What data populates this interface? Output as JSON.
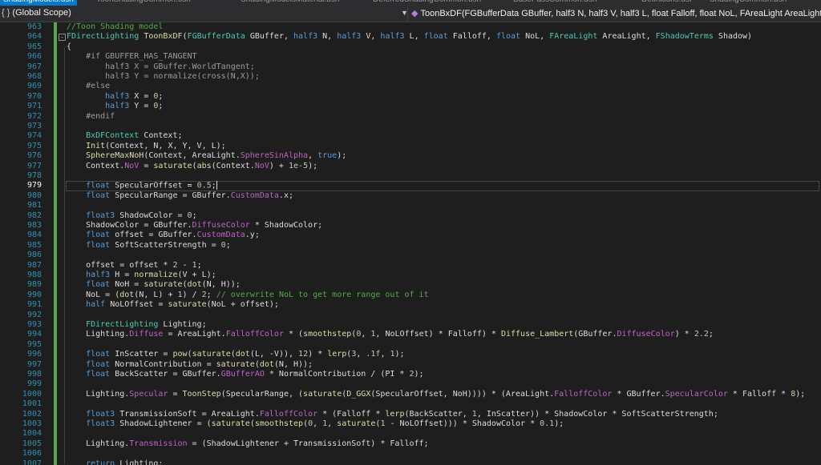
{
  "tabs": [
    {
      "label": "ShadingModels.ush",
      "active": true
    },
    {
      "label": "ToonShadingCommon.ush",
      "active": false
    },
    {
      "label": "ShadingModelsMaterial.ush",
      "active": false
    },
    {
      "label": "DeferredShadingCommon.ush",
      "active": false
    },
    {
      "label": "BasePassCommon.ush",
      "active": false
    },
    {
      "label": "Definitions.usf",
      "active": false
    },
    {
      "label": "ShadingCommon.ush",
      "active": false
    }
  ],
  "navbar": {
    "scope_icon": "{ }",
    "scope_label": "(Global Scope)",
    "function_label": "ToonBxDF(FGBufferData GBuffer, half3 N, half3 V, half3 L, float Falloff, float NoL, FAreaLight AreaLight, FShadowTerms Shadow)",
    "function_icon": "cube-icon"
  },
  "editor": {
    "current_line": 979,
    "lines": [
      {
        "n": "963",
        "tokens": [
          {
            "c": "c",
            "t": "//Toon Shading model"
          }
        ]
      },
      {
        "n": "964",
        "fold": "-",
        "tokens": [
          {
            "c": "t",
            "t": "FDirectLighting"
          },
          {
            "c": "v",
            "t": " "
          },
          {
            "c": "f",
            "t": "ToonBxDF"
          },
          {
            "c": "v",
            "t": "("
          },
          {
            "c": "t",
            "t": "FGBufferData"
          },
          {
            "c": "v",
            "t": " GBuffer, "
          },
          {
            "c": "k",
            "t": "half3"
          },
          {
            "c": "v",
            "t": " N, "
          },
          {
            "c": "k",
            "t": "half3"
          },
          {
            "c": "v",
            "t": " V, "
          },
          {
            "c": "k",
            "t": "half3"
          },
          {
            "c": "v",
            "t": " L, "
          },
          {
            "c": "k",
            "t": "float"
          },
          {
            "c": "v",
            "t": " Falloff, "
          },
          {
            "c": "k",
            "t": "float"
          },
          {
            "c": "v",
            "t": " NoL, "
          },
          {
            "c": "t",
            "t": "FAreaLight"
          },
          {
            "c": "v",
            "t": " AreaLight, "
          },
          {
            "c": "t",
            "t": "FShadowTerms"
          },
          {
            "c": "v",
            "t": " Shadow)"
          }
        ]
      },
      {
        "n": "965",
        "tokens": [
          {
            "c": "v",
            "t": "{"
          }
        ]
      },
      {
        "n": "966",
        "tokens": [
          {
            "c": "p",
            "t": "    #if GBUFFER_HAS_TANGENT"
          }
        ]
      },
      {
        "n": "967",
        "tokens": [
          {
            "c": "p",
            "t": "        half3 X = GBuffer.WorldTangent;"
          }
        ]
      },
      {
        "n": "968",
        "tokens": [
          {
            "c": "p",
            "t": "        half3 Y = normalize(cross(N,X));"
          }
        ]
      },
      {
        "n": "969",
        "tokens": [
          {
            "c": "p",
            "t": "    #else"
          }
        ]
      },
      {
        "n": "970",
        "tokens": [
          {
            "c": "k",
            "t": "        half3"
          },
          {
            "c": "v",
            "t": " X = "
          },
          {
            "c": "n",
            "t": "0"
          },
          {
            "c": "v",
            "t": ";"
          }
        ]
      },
      {
        "n": "971",
        "tokens": [
          {
            "c": "k",
            "t": "        half3"
          },
          {
            "c": "v",
            "t": " Y = "
          },
          {
            "c": "n",
            "t": "0"
          },
          {
            "c": "v",
            "t": ";"
          }
        ]
      },
      {
        "n": "972",
        "tokens": [
          {
            "c": "p",
            "t": "    #endif"
          }
        ]
      },
      {
        "n": "973",
        "tokens": []
      },
      {
        "n": "974",
        "tokens": [
          {
            "c": "t",
            "t": "    BxDFContext"
          },
          {
            "c": "v",
            "t": " Context;"
          }
        ]
      },
      {
        "n": "975",
        "tokens": [
          {
            "c": "f",
            "t": "    Init"
          },
          {
            "c": "v",
            "t": "(Context, N, X, Y, V, L);"
          }
        ]
      },
      {
        "n": "976",
        "tokens": [
          {
            "c": "f",
            "t": "    SphereMaxNoH"
          },
          {
            "c": "v",
            "t": "(Context, AreaLight."
          },
          {
            "c": "m",
            "t": "SphereSinAlpha"
          },
          {
            "c": "v",
            "t": ", "
          },
          {
            "c": "k",
            "t": "true"
          },
          {
            "c": "v",
            "t": ");"
          }
        ]
      },
      {
        "n": "977",
        "tokens": [
          {
            "c": "v",
            "t": "    Context."
          },
          {
            "c": "m",
            "t": "NoV"
          },
          {
            "c": "v",
            "t": " = "
          },
          {
            "c": "f",
            "t": "saturate"
          },
          {
            "c": "v",
            "t": "("
          },
          {
            "c": "f",
            "t": "abs"
          },
          {
            "c": "v",
            "t": "(Context."
          },
          {
            "c": "m",
            "t": "NoV"
          },
          {
            "c": "v",
            "t": ") + "
          },
          {
            "c": "n",
            "t": "1e-5"
          },
          {
            "c": "v",
            "t": ");"
          }
        ]
      },
      {
        "n": "978",
        "tokens": []
      },
      {
        "n": "979",
        "cursor": true,
        "tokens": [
          {
            "c": "k",
            "t": "    float"
          },
          {
            "c": "v",
            "t": " SpecularOffset = "
          },
          {
            "c": "n",
            "t": "0.5"
          },
          {
            "c": "v",
            "t": ";"
          }
        ]
      },
      {
        "n": "980",
        "tokens": [
          {
            "c": "k",
            "t": "    float"
          },
          {
            "c": "v",
            "t": " SpecularRange = GBuffer."
          },
          {
            "c": "m",
            "t": "CustomData"
          },
          {
            "c": "v",
            "t": ".x;"
          }
        ]
      },
      {
        "n": "981",
        "tokens": []
      },
      {
        "n": "982",
        "tokens": [
          {
            "c": "k",
            "t": "    float3"
          },
          {
            "c": "v",
            "t": " ShadowColor = "
          },
          {
            "c": "n",
            "t": "0"
          },
          {
            "c": "v",
            "t": ";"
          }
        ]
      },
      {
        "n": "983",
        "tokens": [
          {
            "c": "v",
            "t": "    ShadowColor = GBuffer."
          },
          {
            "c": "m",
            "t": "DiffuseColor"
          },
          {
            "c": "v",
            "t": " * ShadowColor;"
          }
        ]
      },
      {
        "n": "984",
        "tokens": [
          {
            "c": "k",
            "t": "    float"
          },
          {
            "c": "v",
            "t": " offset = GBuffer."
          },
          {
            "c": "m",
            "t": "CustomData"
          },
          {
            "c": "v",
            "t": ".y;"
          }
        ]
      },
      {
        "n": "985",
        "tokens": [
          {
            "c": "k",
            "t": "    float"
          },
          {
            "c": "v",
            "t": " SoftScatterStrength = "
          },
          {
            "c": "n",
            "t": "0"
          },
          {
            "c": "v",
            "t": ";"
          }
        ]
      },
      {
        "n": "986",
        "tokens": []
      },
      {
        "n": "987",
        "tokens": [
          {
            "c": "v",
            "t": "    offset = offset * "
          },
          {
            "c": "n",
            "t": "2"
          },
          {
            "c": "v",
            "t": " - "
          },
          {
            "c": "n",
            "t": "1"
          },
          {
            "c": "v",
            "t": ";"
          }
        ]
      },
      {
        "n": "988",
        "tokens": [
          {
            "c": "k",
            "t": "    half3"
          },
          {
            "c": "v",
            "t": " H = "
          },
          {
            "c": "f",
            "t": "normalize"
          },
          {
            "c": "v",
            "t": "(V + L);"
          }
        ]
      },
      {
        "n": "989",
        "tokens": [
          {
            "c": "k",
            "t": "    float"
          },
          {
            "c": "v",
            "t": " NoH = "
          },
          {
            "c": "f",
            "t": "saturate"
          },
          {
            "c": "v",
            "t": "("
          },
          {
            "c": "f",
            "t": "dot"
          },
          {
            "c": "v",
            "t": "(N, H));"
          }
        ]
      },
      {
        "n": "990",
        "tokens": [
          {
            "c": "v",
            "t": "    NoL = ("
          },
          {
            "c": "f",
            "t": "dot"
          },
          {
            "c": "v",
            "t": "(N, L) + "
          },
          {
            "c": "n",
            "t": "1"
          },
          {
            "c": "v",
            "t": ") / "
          },
          {
            "c": "n",
            "t": "2"
          },
          {
            "c": "v",
            "t": "; "
          },
          {
            "c": "c",
            "t": "// overwrite NoL to get more range out of it"
          }
        ]
      },
      {
        "n": "991",
        "tokens": [
          {
            "c": "k",
            "t": "    half"
          },
          {
            "c": "v",
            "t": " NoLOffset = "
          },
          {
            "c": "f",
            "t": "saturate"
          },
          {
            "c": "v",
            "t": "(NoL + offset);"
          }
        ]
      },
      {
        "n": "992",
        "tokens": []
      },
      {
        "n": "993",
        "tokens": [
          {
            "c": "t",
            "t": "    FDirectLighting"
          },
          {
            "c": "v",
            "t": " Lighting;"
          }
        ]
      },
      {
        "n": "994",
        "tokens": [
          {
            "c": "v",
            "t": "    Lighting."
          },
          {
            "c": "m",
            "t": "Diffuse"
          },
          {
            "c": "v",
            "t": " = AreaLight."
          },
          {
            "c": "m",
            "t": "FalloffColor"
          },
          {
            "c": "v",
            "t": " * ("
          },
          {
            "c": "f",
            "t": "smoothstep"
          },
          {
            "c": "v",
            "t": "("
          },
          {
            "c": "n",
            "t": "0"
          },
          {
            "c": "v",
            "t": ", "
          },
          {
            "c": "n",
            "t": "1"
          },
          {
            "c": "v",
            "t": ", NoLOffset) * Falloff) * "
          },
          {
            "c": "f",
            "t": "Diffuse_Lambert"
          },
          {
            "c": "v",
            "t": "(GBuffer."
          },
          {
            "c": "m",
            "t": "DiffuseColor"
          },
          {
            "c": "v",
            "t": ") * "
          },
          {
            "c": "n",
            "t": "2.2"
          },
          {
            "c": "v",
            "t": ";"
          }
        ]
      },
      {
        "n": "995",
        "tokens": []
      },
      {
        "n": "996",
        "tokens": [
          {
            "c": "k",
            "t": "    float"
          },
          {
            "c": "v",
            "t": " InScatter = "
          },
          {
            "c": "f",
            "t": "pow"
          },
          {
            "c": "v",
            "t": "("
          },
          {
            "c": "f",
            "t": "saturate"
          },
          {
            "c": "v",
            "t": "("
          },
          {
            "c": "f",
            "t": "dot"
          },
          {
            "c": "v",
            "t": "(L, -V)), "
          },
          {
            "c": "n",
            "t": "12"
          },
          {
            "c": "v",
            "t": ") * "
          },
          {
            "c": "f",
            "t": "lerp"
          },
          {
            "c": "v",
            "t": "("
          },
          {
            "c": "n",
            "t": "3"
          },
          {
            "c": "v",
            "t": ", "
          },
          {
            "c": "n",
            "t": ".1f"
          },
          {
            "c": "v",
            "t": ", "
          },
          {
            "c": "n",
            "t": "1"
          },
          {
            "c": "v",
            "t": ");"
          }
        ]
      },
      {
        "n": "997",
        "tokens": [
          {
            "c": "k",
            "t": "    float"
          },
          {
            "c": "v",
            "t": " NormalContribution = "
          },
          {
            "c": "f",
            "t": "saturate"
          },
          {
            "c": "v",
            "t": "("
          },
          {
            "c": "f",
            "t": "dot"
          },
          {
            "c": "v",
            "t": "(N, H));"
          }
        ]
      },
      {
        "n": "998",
        "tokens": [
          {
            "c": "k",
            "t": "    float"
          },
          {
            "c": "v",
            "t": " BackScatter = GBuffer."
          },
          {
            "c": "m",
            "t": "GBufferAO"
          },
          {
            "c": "v",
            "t": " * NormalContribution / (PI * "
          },
          {
            "c": "n",
            "t": "2"
          },
          {
            "c": "v",
            "t": ");"
          }
        ]
      },
      {
        "n": "999",
        "tokens": []
      },
      {
        "n": "1000",
        "tokens": [
          {
            "c": "v",
            "t": "    Lighting."
          },
          {
            "c": "m",
            "t": "Specular"
          },
          {
            "c": "v",
            "t": " = "
          },
          {
            "c": "f",
            "t": "ToonStep"
          },
          {
            "c": "v",
            "t": "(SpecularRange, ("
          },
          {
            "c": "f",
            "t": "saturate"
          },
          {
            "c": "v",
            "t": "("
          },
          {
            "c": "f",
            "t": "D_GGX"
          },
          {
            "c": "v",
            "t": "(SpecularOffset, NoH)))) * (AreaLight."
          },
          {
            "c": "m",
            "t": "FalloffColor"
          },
          {
            "c": "v",
            "t": " * GBuffer."
          },
          {
            "c": "m",
            "t": "SpecularColor"
          },
          {
            "c": "v",
            "t": " * Falloff * "
          },
          {
            "c": "n",
            "t": "8"
          },
          {
            "c": "v",
            "t": ");"
          }
        ]
      },
      {
        "n": "1001",
        "tokens": []
      },
      {
        "n": "1002",
        "tokens": [
          {
            "c": "k",
            "t": "    float3"
          },
          {
            "c": "v",
            "t": " TransmissionSoft = AreaLight."
          },
          {
            "c": "m",
            "t": "FalloffColor"
          },
          {
            "c": "v",
            "t": " * (Falloff * "
          },
          {
            "c": "f",
            "t": "lerp"
          },
          {
            "c": "v",
            "t": "(BackScatter, "
          },
          {
            "c": "n",
            "t": "1"
          },
          {
            "c": "v",
            "t": ", InScatter)) * ShadowColor * SoftScatterStrength;"
          }
        ]
      },
      {
        "n": "1003",
        "tokens": [
          {
            "c": "k",
            "t": "    float3"
          },
          {
            "c": "v",
            "t": " ShadowLightener = ("
          },
          {
            "c": "f",
            "t": "saturate"
          },
          {
            "c": "v",
            "t": "("
          },
          {
            "c": "f",
            "t": "smoothstep"
          },
          {
            "c": "v",
            "t": "("
          },
          {
            "c": "n",
            "t": "0"
          },
          {
            "c": "v",
            "t": ", "
          },
          {
            "c": "n",
            "t": "1"
          },
          {
            "c": "v",
            "t": ", "
          },
          {
            "c": "f",
            "t": "saturate"
          },
          {
            "c": "v",
            "t": "("
          },
          {
            "c": "n",
            "t": "1"
          },
          {
            "c": "v",
            "t": " - NoLOffset))) * ShadowColor * "
          },
          {
            "c": "n",
            "t": "0.1"
          },
          {
            "c": "v",
            "t": ");"
          }
        ]
      },
      {
        "n": "1004",
        "tokens": []
      },
      {
        "n": "1005",
        "tokens": [
          {
            "c": "v",
            "t": "    Lighting."
          },
          {
            "c": "m",
            "t": "Transmission"
          },
          {
            "c": "v",
            "t": " = (ShadowLightener + TransmissionSoft) * Falloff;"
          }
        ]
      },
      {
        "n": "1006",
        "tokens": []
      },
      {
        "n": "1007",
        "tokens": [
          {
            "c": "k",
            "t": "    return"
          },
          {
            "c": "v",
            "t": " Lighting;"
          }
        ]
      }
    ]
  }
}
